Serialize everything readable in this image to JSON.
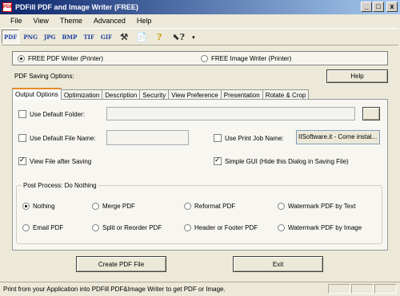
{
  "window": {
    "title": "PDFill PDF and Image Writer (FREE)",
    "app_icon_text": "PDF",
    "minimize_glyph": "_",
    "maximize_glyph": "□",
    "close_glyph": "x"
  },
  "menu": [
    "File",
    "View",
    "Theme",
    "Advanced",
    "Help"
  ],
  "toolbar": {
    "formats": [
      "PDF",
      "PNG",
      "JPG",
      "BMP",
      "TIF",
      "GIF"
    ],
    "icons": [
      {
        "name": "tools-icon",
        "glyph": "⚒"
      },
      {
        "name": "document-icon",
        "glyph": "📄"
      },
      {
        "name": "help-question-icon",
        "glyph": "?"
      },
      {
        "name": "whats-this-icon",
        "glyph": "⬉?"
      }
    ],
    "overflow_glyph": "▾"
  },
  "writer_mode": {
    "pdf_label": "FREE PDF Writer (Printer)",
    "image_label": "FREE Image Writer (Printer)",
    "selected": "pdf"
  },
  "saving_options_label": "PDF Saving Options:",
  "help_button": "Help",
  "tabs": [
    "Output Options",
    "Optimization",
    "Description",
    "Security",
    "View Preference",
    "Presentation",
    "Rotate & Crop"
  ],
  "active_tab": "Output Options",
  "output_options": {
    "use_default_folder": {
      "label": "Use Default Folder:",
      "checked": false,
      "value": ""
    },
    "browse_button": "",
    "use_default_file_name": {
      "label": "Use Default File Name:",
      "checked": false,
      "value": ""
    },
    "use_print_job_name": {
      "label": "Use Print Job Name:",
      "checked": false,
      "value": "IISoftware.it - Come instal..."
    },
    "view_file_after_saving": {
      "label": "View File after Saving",
      "checked": true
    },
    "simple_gui": {
      "label": "Simple GUI (Hide this Dialog in Saving File)",
      "checked": true
    },
    "post_process": {
      "label": "Post Process: Do Nothing",
      "options": [
        "Nothing",
        "Merge PDF",
        "Reformat PDF",
        "Watermark PDF by Text",
        "Email PDF",
        "Split or Reorder PDF",
        "Header or Footer PDF",
        "Watermark PDF by Image"
      ],
      "selected": "Nothing"
    }
  },
  "buttons": {
    "create": "Create PDF File",
    "exit": "Exit"
  },
  "status": {
    "text": "Print from your Application into PDFill PDF&Image Writer to get PDF or Image."
  }
}
